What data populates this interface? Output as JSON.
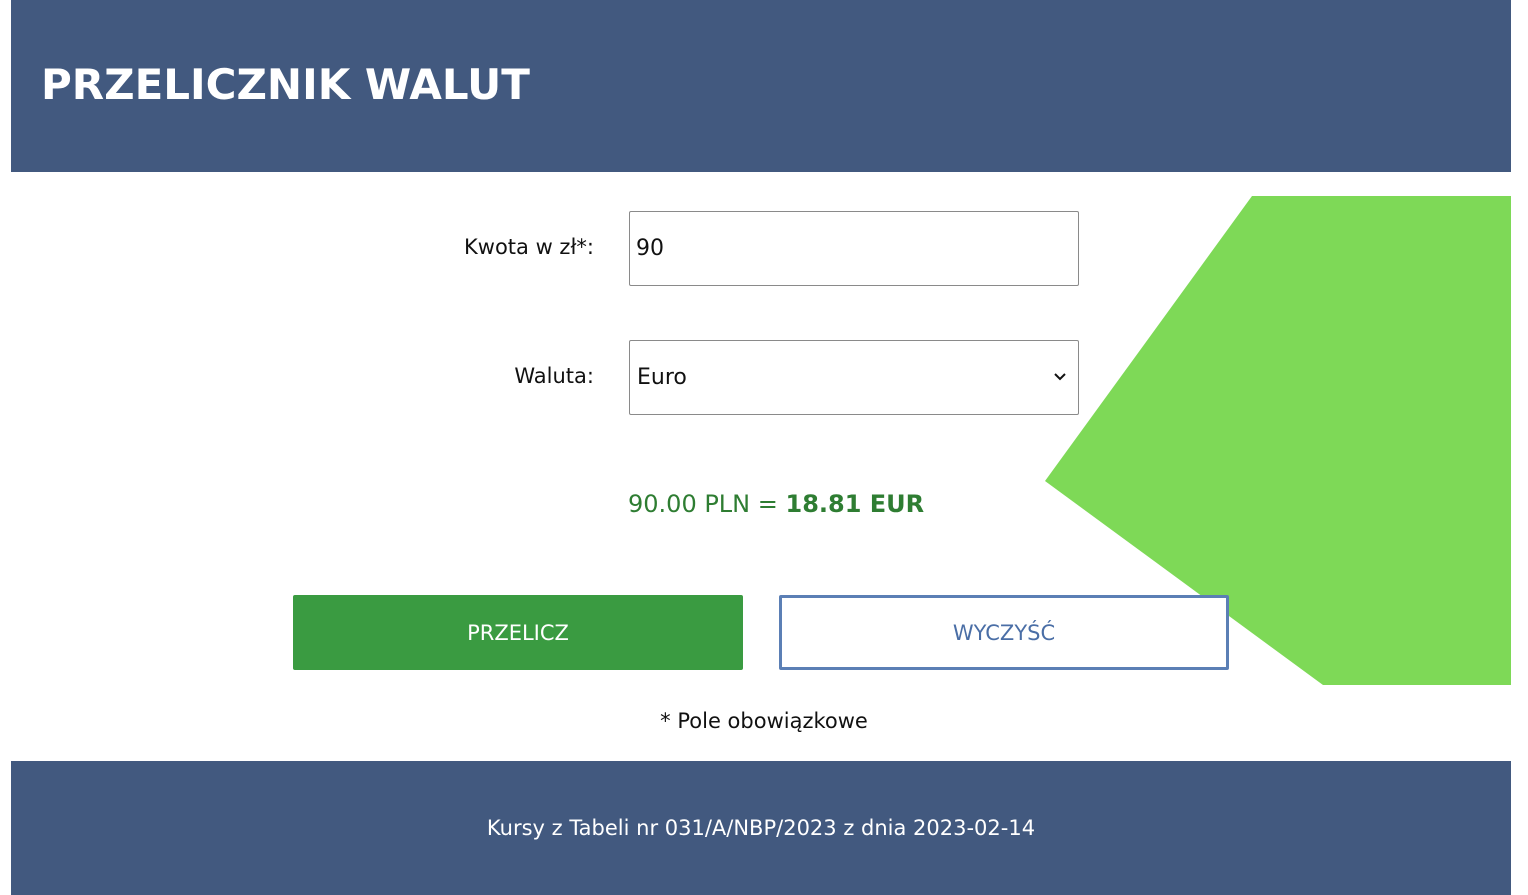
{
  "header": {
    "title": "PRZELICZNIK WALUT"
  },
  "form": {
    "amount_label": "Kwota w zł*:",
    "amount_value": "90",
    "currency_label": "Waluta:",
    "currency_selected": "Euro"
  },
  "result": {
    "prefix": "90.00 PLN = ",
    "value": "18.81 EUR"
  },
  "buttons": {
    "convert": "PRZELICZ",
    "clear": "WYCZYŚĆ"
  },
  "required_note": "* Pole obowiązkowe",
  "footer": {
    "text": "Kursy z Tabeli nr 031/A/NBP/2023 z dnia 2023-02-14"
  },
  "colors": {
    "header_bg": "#42597f",
    "accent_green": "#7ed957",
    "button_green": "#3a9b41",
    "result_green": "#2e7d32",
    "outline_blue": "#5b7fb5"
  },
  "icons": {
    "select_chevron": "chevron-down-icon"
  }
}
